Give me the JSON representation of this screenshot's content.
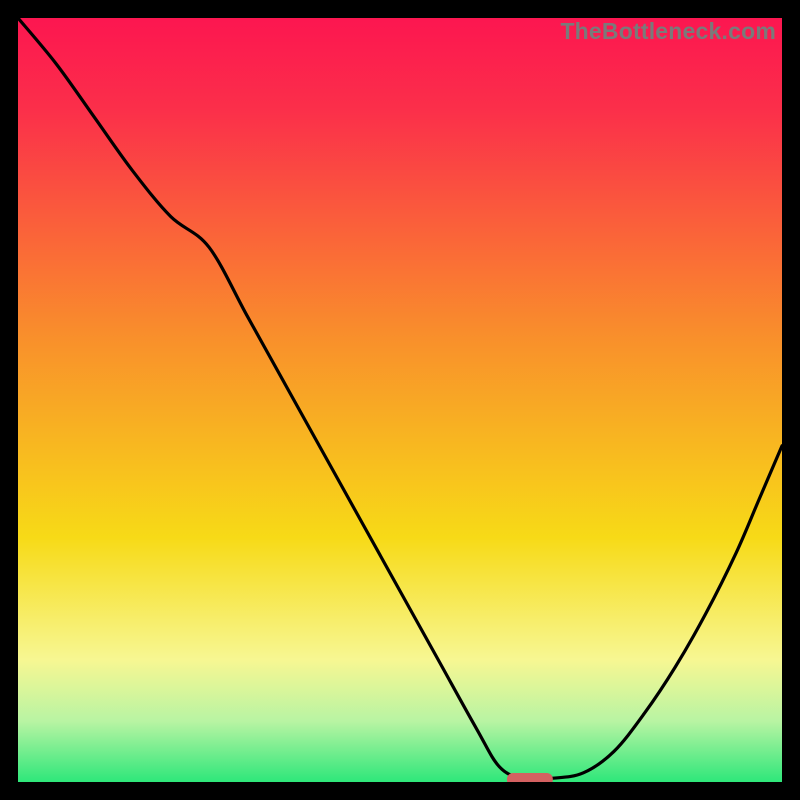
{
  "watermark": "TheBottleneck.com",
  "colors": {
    "top": "#fc1650",
    "red": "#fb2f4a",
    "orange": "#f9902b",
    "yellow": "#f7da17",
    "paleyellow": "#f7f792",
    "palegreen": "#b9f4a3",
    "green": "#2ee77a",
    "marker": "#d46161",
    "line": "#000000"
  },
  "chart_data": {
    "type": "line",
    "title": "",
    "xlabel": "",
    "ylabel": "",
    "xlim": [
      0,
      100
    ],
    "ylim": [
      0,
      100
    ],
    "x": [
      0,
      5,
      10,
      15,
      20,
      25,
      30,
      35,
      40,
      45,
      50,
      55,
      60,
      63,
      66,
      70,
      74,
      78,
      82,
      86,
      90,
      94,
      97,
      100
    ],
    "y": [
      100,
      94,
      87,
      80,
      74,
      70,
      61,
      52,
      43,
      34,
      25,
      16,
      7,
      2,
      0.5,
      0.5,
      1.2,
      4,
      9,
      15,
      22,
      30,
      37,
      44
    ],
    "marker": {
      "x_start": 64,
      "x_end": 70,
      "y": 0.4
    }
  }
}
